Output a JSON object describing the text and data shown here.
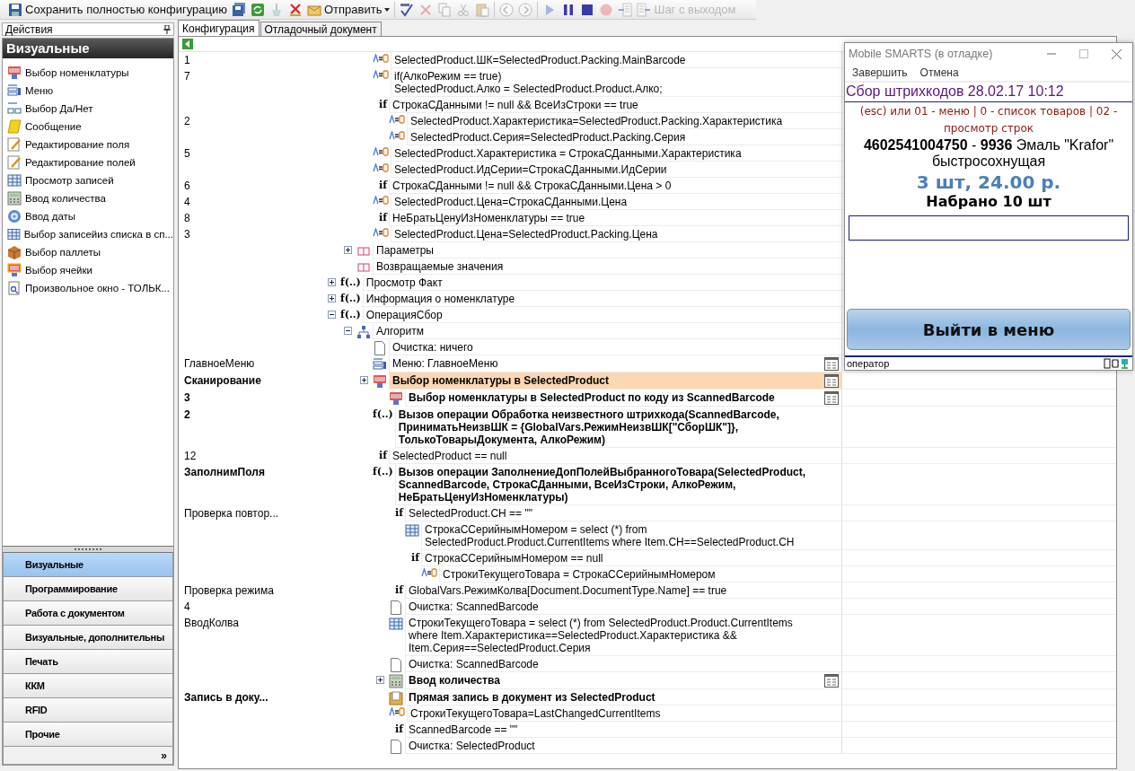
{
  "toolbar": {
    "groups": [
      [
        {
          "kind": "save",
          "label": "Сохранить полностью конфигурацию",
          "disabled": false
        },
        {
          "kind": "save-all",
          "disabled": false
        },
        {
          "kind": "refresh",
          "disabled": false
        },
        {
          "kind": "clean",
          "disabled": true
        },
        {
          "kind": "delete",
          "disabled": false
        },
        {
          "kind": "send",
          "label": "Отправить",
          "disabled": false
        }
      ],
      [
        {
          "kind": "spellcheck",
          "disabled": false
        },
        {
          "kind": "cancel",
          "disabled": true
        },
        {
          "kind": "copy",
          "disabled": true
        },
        {
          "kind": "cut",
          "disabled": true
        },
        {
          "kind": "paste",
          "disabled": true
        }
      ],
      [
        {
          "kind": "back",
          "disabled": true
        },
        {
          "kind": "forward",
          "disabled": true
        }
      ],
      [
        {
          "kind": "play",
          "disabled": true
        },
        {
          "kind": "pause",
          "disabled": false
        },
        {
          "kind": "stop",
          "disabled": false
        },
        {
          "kind": "record",
          "disabled": true
        },
        {
          "kind": "step-in",
          "disabled": true
        },
        {
          "kind": "step-out",
          "label": "Шаг с выходом",
          "disabled": true
        }
      ]
    ]
  },
  "sidebar": {
    "title": "Действия",
    "section": "Визуальные",
    "items": [
      {
        "kind": "barcode",
        "label": "Выбор номенклатуры"
      },
      {
        "kind": "menu",
        "label": "Меню"
      },
      {
        "kind": "yesno",
        "label": "Выбор Да/Нет"
      },
      {
        "kind": "message",
        "label": "Сообщение"
      },
      {
        "kind": "edit",
        "label": "Редактирование поля"
      },
      {
        "kind": "edit",
        "label": "Редактирование полей"
      },
      {
        "kind": "grid",
        "label": "Просмотр записей"
      },
      {
        "kind": "calc",
        "label": "Ввод количества"
      },
      {
        "kind": "date",
        "label": "Ввод даты"
      },
      {
        "kind": "grid",
        "label": "Выбор записейиз списка в сп..."
      },
      {
        "kind": "pallet",
        "label": "Выбор паллеты"
      },
      {
        "kind": "cell",
        "label": "Выбор ячейки"
      },
      {
        "kind": "window",
        "label": "Произвольное окно - ТОЛЬК..."
      }
    ],
    "nav": [
      {
        "label": "Визуальные",
        "selected": true
      },
      {
        "label": "Программирование",
        "selected": false
      },
      {
        "label": "Работа с документом",
        "selected": false
      },
      {
        "label": "Визуальные, дополнительны",
        "selected": false
      },
      {
        "label": "Печать",
        "selected": false
      },
      {
        "label": "ККМ",
        "selected": false
      },
      {
        "label": "RFID",
        "selected": false
      },
      {
        "label": "Прочие",
        "selected": false
      }
    ],
    "more": "»"
  },
  "tabs": [
    {
      "label": "Конфигурация",
      "selected": true
    },
    {
      "label": "Отладочный документ",
      "selected": false
    }
  ],
  "tree": [
    {
      "children": [
        {
          "children": [
            {
              "label": "1",
              "kind": "assign",
              "text": "SelectedProduct.ШК=SelectedProduct.Packing.MainBarcode",
              "selected": false
            },
            {
              "label": "7",
              "kind": "assign",
              "text": "if(АлкоРежим == true)\nSelectedProduct.Алко = SelectedProduct.Product.Алко;",
              "selected": false
            },
            {
              "kind": "if",
              "glyph": "if",
              "text": "СтрокаСДанными != null && ВсеИзСтроки == true",
              "selected": false,
              "children": [
                {
                  "label": "2",
                  "kind": "assign",
                  "text": "SelectedProduct.Характеристика=SelectedProduct.Packing.Характеристика",
                  "selected": false
                },
                {
                  "kind": "assign",
                  "text": "SelectedProduct.Серия=SelectedProduct.Packing.Серия",
                  "selected": false
                }
              ]
            },
            {
              "label": "5",
              "kind": "assign",
              "text": "SelectedProduct.Характеристика = СтрокаСДанными.Характеристика",
              "selected": false
            },
            {
              "kind": "assign",
              "text": "SelectedProduct.ИдСерии=СтрокаСДанными.ИдСерии",
              "selected": false
            },
            {
              "label": "6",
              "kind": "if",
              "glyph": "if",
              "text": "СтрокаСДанными != null && СтрокаСДанными.Цена > 0",
              "selected": false
            },
            {
              "label": "4",
              "kind": "assign",
              "text": "SelectedProduct.Цена=СтрокаСДанными.Цена",
              "selected": false
            },
            {
              "label": "8",
              "kind": "if",
              "glyph": "if",
              "text": "НеБратьЦенуИзНоменклатуры == true",
              "selected": false
            },
            {
              "label": "3",
              "kind": "assign",
              "text": "SelectedProduct.Цена=SelectedProduct.Packing.Цена",
              "selected": false
            }
          ]
        },
        {
          "kind": "params",
          "text": "Параметры",
          "expanded": false,
          "selected": false
        },
        {
          "kind": "params",
          "text": "Возвращаемые значения",
          "selected": false
        }
      ]
    },
    {
      "kind": "func",
      "glyph": "f(..)",
      "text": "Просмотр Факт",
      "expanded": false,
      "selected": false
    },
    {
      "kind": "func",
      "glyph": "f(..)",
      "text": "Информация о номенклатуре",
      "expanded": false,
      "selected": false
    },
    {
      "kind": "func",
      "glyph": "f(..)",
      "text": "ОперацияСбор",
      "expanded": true,
      "selected": false,
      "children": [
        {
          "kind": "algo",
          "text": "Алгоритм",
          "expanded": true,
          "selected": false,
          "children": [
            {
              "kind": "page",
              "text": "Очистка: ничего",
              "selected": false
            },
            {
              "label": "ГлавноеМеню",
              "kind": "menu",
              "text": "Меню: ГлавноеМеню",
              "screen": true,
              "selected": false
            },
            {
              "label": "Сканирование",
              "bold": true,
              "kind": "barcode",
              "text": "Выбор номенклатуры в SelectedProduct",
              "expanded": false,
              "screen": true,
              "selected": true
            },
            {
              "children": [
                {
                  "label": "3",
                  "bold": true,
                  "kind": "barcode",
                  "text": "Выбор номенклатуры в SelectedProduct по коду из ScannedBarcode",
                  "screen": true,
                  "selected": false
                }
              ]
            },
            {
              "label": "2",
              "bold": true,
              "kind": "func",
              "glyph": "f(..)",
              "text": "Вызов операции Обработка неизвестного штрихкода(ScannedBarcode,\nПриниматьНеизвШК = {GlobalVars.РежимНеизвШК[\"СборШК\"]},\nТолькоТоварыДокумента, АлкоРежим)",
              "selected": false
            },
            {
              "label": "12",
              "kind": "if",
              "glyph": "if",
              "text": "SelectedProduct == null",
              "selected": false
            },
            {
              "label": "ЗаполнимПоля",
              "bold": true,
              "kind": "func",
              "glyph": "f(..)",
              "text": "Вызов операции ЗаполнениеДопПолейВыбранногоТовара(SelectedProduct,\nScannedBarcode, СтрокаСДанными, ВсеИзСтроки, АлкоРежим,\nНеБратьЦенуИзНоменклатуры)",
              "selected": false
            },
            {
              "children": [
                {
                  "label": "Проверка повтор...",
                  "kind": "if",
                  "glyph": "if",
                  "text": "SelectedProduct.СН == \"\"",
                  "selected": false,
                  "children": [
                    {
                      "kind": "table",
                      "text": "СтрокаССерийнымНомером = select (*) from\nSelectedProduct.Product.CurrentItems where Item.СН==SelectedProduct.СН",
                      "selected": false
                    },
                    {
                      "kind": "if",
                      "glyph": "if",
                      "text": "СтрокаССерийнымНомером == null",
                      "selected": false,
                      "children": [
                        {
                          "kind": "assign",
                          "text": "СтрокиТекущегоТовара = СтрокаССерийнымНомером",
                          "selected": false
                        }
                      ]
                    }
                  ]
                },
                {
                  "label": "Проверка режима",
                  "kind": "if",
                  "glyph": "if",
                  "text": "GlobalVars.РежимКолва[Document.DocumentType.Name] == true",
                  "selected": false
                },
                {
                  "label": "4",
                  "kind": "page",
                  "text": "Очистка: ScannedBarcode",
                  "selected": false
                },
                {
                  "label": "ВводКолва",
                  "kind": "table",
                  "text": "СтрокиТекущегоТовара = select (*) from SelectedProduct.Product.CurrentItems\nwhere Item.Характеристика==SelectedProduct.Характеристика &&\nItem.Серия==SelectedProduct.Серия",
                  "selected": false
                },
                {
                  "kind": "page",
                  "text": "Очистка: ScannedBarcode",
                  "selected": false
                },
                {
                  "bold": true,
                  "kind": "calc",
                  "text": "Ввод количества",
                  "expanded": false,
                  "screen": true,
                  "selected": false
                },
                {
                  "label": "Запись в доку...",
                  "bold": true,
                  "kind": "write",
                  "text": "Прямая запись в документ из SelectedProduct",
                  "selected": false
                },
                {
                  "kind": "assign",
                  "text": "СтрокиТекущегоТовара=LastChangedCurrentItems",
                  "selected": false
                },
                {
                  "kind": "if",
                  "glyph": "if",
                  "text": "ScannedBarcode == \"\"",
                  "selected": false
                },
                {
                  "kind": "page",
                  "text": "Очистка: SelectedProduct",
                  "selected": false
                }
              ]
            }
          ]
        }
      ]
    }
  ],
  "device": {
    "title": "Mobile SMARTS (в отладке)",
    "menu": [
      "Завершить",
      "Отмена"
    ],
    "header": "Сбор штрихкодов 28.02.17 10:12",
    "hint": "(esc) или 01 - меню | 0 - список товаров | 02 - просмотр строк",
    "product": "**4602541004750** - **9936** Эмаль \"Krafor\" быстросохнущая",
    "price": "3 шт, 24.00 р.",
    "collected": "Набрано 10 шт",
    "button": "Выйти в меню",
    "status": "оператор"
  }
}
